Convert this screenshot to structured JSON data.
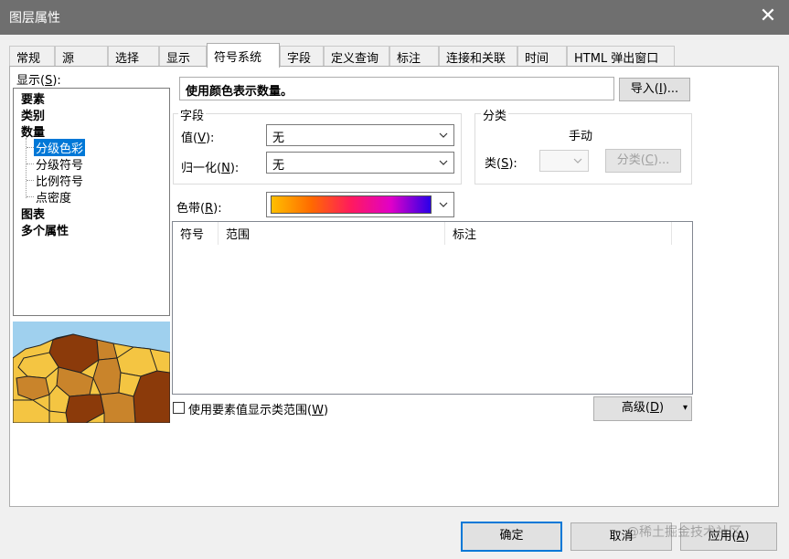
{
  "window": {
    "title": "图层属性",
    "close_glyph": "✕"
  },
  "tabs": [
    {
      "label": "常规"
    },
    {
      "label": "源"
    },
    {
      "label": "选择"
    },
    {
      "label": "显示"
    },
    {
      "label": "符号系统",
      "active": true
    },
    {
      "label": "字段"
    },
    {
      "label": "定义查询"
    },
    {
      "label": "标注"
    },
    {
      "label": "连接和关联"
    },
    {
      "label": "时间"
    },
    {
      "label": "HTML 弹出窗口"
    }
  ],
  "show": {
    "label": "显示(",
    "accel": "S",
    "label_tail": "):",
    "items": [
      {
        "label": "要素",
        "bold": true
      },
      {
        "label": "类别",
        "bold": true
      },
      {
        "label": "数量",
        "bold": true
      },
      {
        "label": "分级色彩",
        "sub": true,
        "selected": true
      },
      {
        "label": "分级符号",
        "sub": true
      },
      {
        "label": "比例符号",
        "sub": true
      },
      {
        "label": "点密度",
        "sub": true
      },
      {
        "label": "图表",
        "bold": true
      },
      {
        "label": "多个属性",
        "bold": true
      }
    ]
  },
  "description": "使用颜色表示数量。",
  "import_button": {
    "label": "导入(",
    "accel": "I",
    "tail": ")..."
  },
  "fields_group": {
    "title": "字段",
    "value_label": "值(",
    "value_accel": "V",
    "value_tail": "):",
    "value_selected": "无",
    "normalize_label": "归一化(",
    "normalize_accel": "N",
    "normalize_tail": "):",
    "normalize_selected": "无"
  },
  "classification_group": {
    "title": "分类",
    "method": "手动",
    "classes_label": "类(",
    "classes_accel": "S",
    "classes_tail": "):",
    "classify_button": {
      "label": "分类(",
      "accel": "C",
      "tail": ")..."
    }
  },
  "color_ramp": {
    "label": "色带(",
    "accel": "R",
    "tail": "):",
    "colors": [
      "#ffbf00",
      "#ff6a00",
      "#ff1a5e",
      "#e000c8",
      "#2a00e8"
    ]
  },
  "table": {
    "columns": [
      "符号",
      "范围",
      "标注"
    ]
  },
  "use_feature_values": {
    "label": "使用要素值显示类范围(",
    "accel": "W",
    "tail": ")"
  },
  "advanced_button": {
    "label": "高级(",
    "accel": "D",
    "tail": ")",
    "dropdown": "▾"
  },
  "footer": {
    "ok": "确定",
    "cancel": "取消",
    "apply_label": "应用(",
    "apply_accel": "A",
    "apply_tail": ")"
  },
  "watermark": "@稀土掘金技术社区",
  "colors": {
    "titlebar": "#6f6f6f",
    "selection": "#0078d7",
    "map_sea": "#9fd0ee",
    "map_dark": "#8b3a0a",
    "map_mid": "#c9842b",
    "map_light": "#f4c542"
  }
}
